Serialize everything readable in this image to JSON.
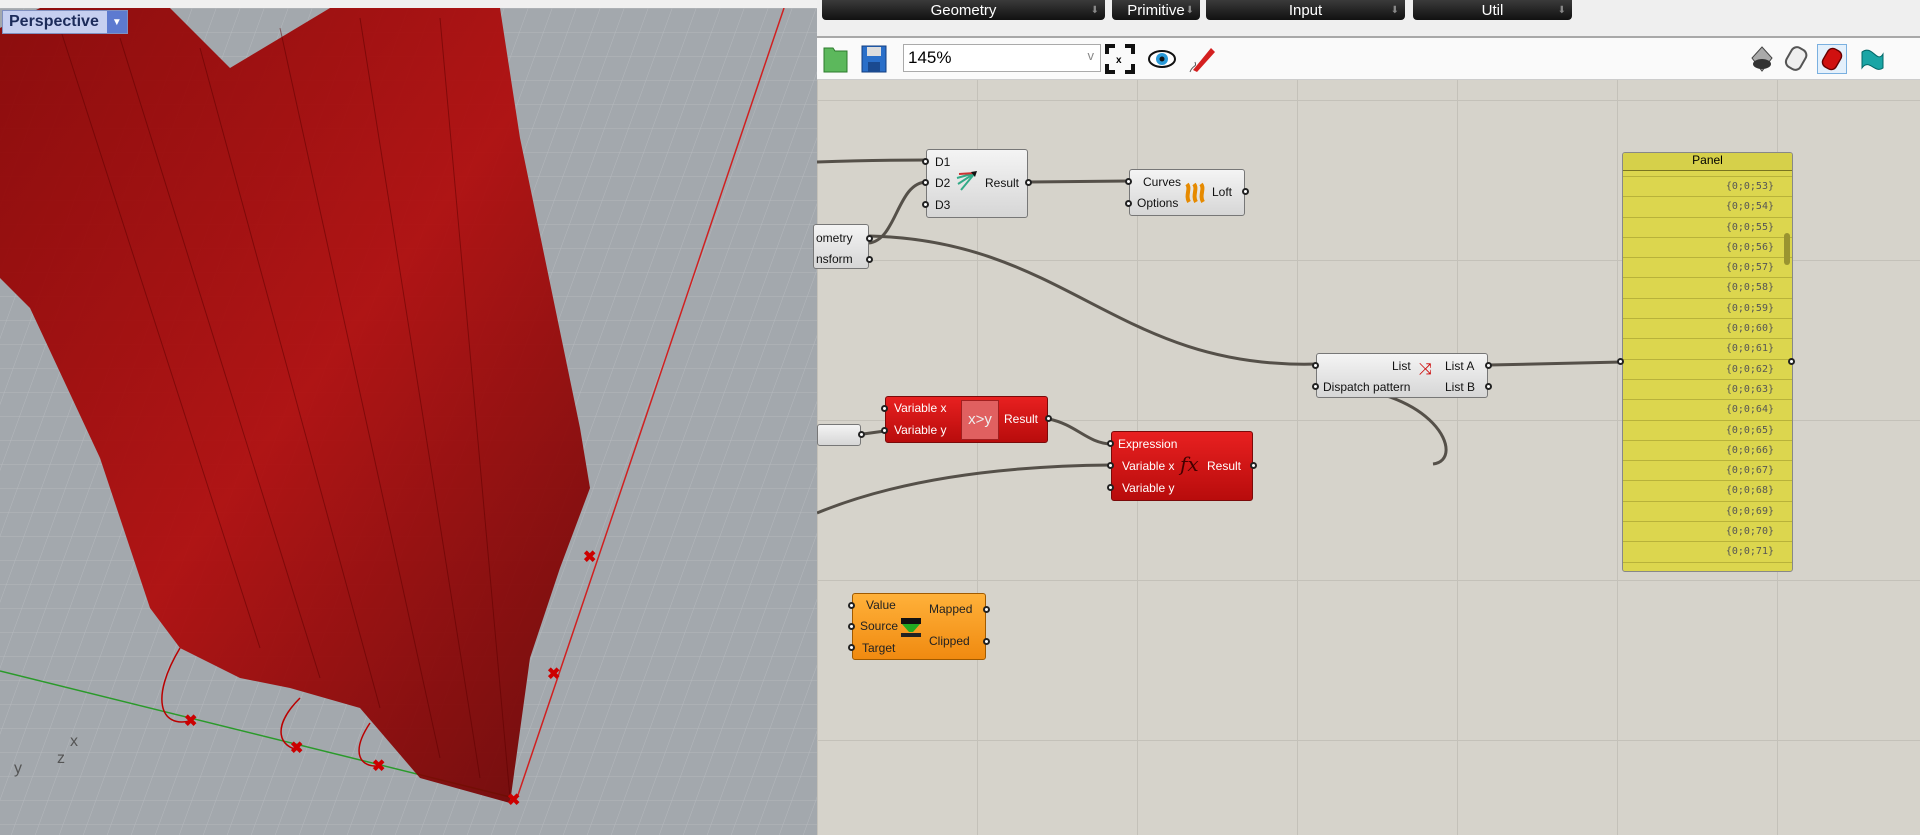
{
  "viewport": {
    "label": "Perspective",
    "axes": {
      "x": "x",
      "y": "y",
      "z": "z"
    }
  },
  "tabs": [
    {
      "label": "Geometry"
    },
    {
      "label": "Primitive"
    },
    {
      "label": "Input"
    },
    {
      "label": "Util"
    }
  ],
  "toolbar": {
    "zoom": "145%"
  },
  "components": {
    "merge": {
      "inputs": [
        "D1",
        "D2",
        "D3"
      ],
      "output": "Result"
    },
    "loft": {
      "inputs": [
        "Curves",
        "Options"
      ],
      "output": "Loft"
    },
    "transform": {
      "outputs": [
        "ometry",
        "nsform"
      ]
    },
    "dispatch": {
      "inputs": [
        "List",
        "Dispatch pattern"
      ],
      "outputs": [
        "List A",
        "List B"
      ]
    },
    "compare": {
      "inputs": [
        "Variable x",
        "Variable y"
      ],
      "label": "x>y",
      "output": "Result"
    },
    "expression": {
      "inputs": [
        "Expression",
        "Variable x",
        "Variable y"
      ],
      "output": "Result"
    },
    "remap": {
      "inputs": [
        "Value",
        "Source",
        "Target"
      ],
      "outputs": [
        "Mapped",
        "Clipped"
      ]
    }
  },
  "panel": {
    "title": "Panel",
    "items": [
      "{0;0;53}",
      "{0;0;54}",
      "{0;0;55}",
      "{0;0;56}",
      "{0;0;57}",
      "{0;0;58}",
      "{0;0;59}",
      "{0;0;60}",
      "{0;0;61}",
      "{0;0;62}",
      "{0;0;63}",
      "{0;0;64}",
      "{0;0;65}",
      "{0;0;66}",
      "{0;0;67}",
      "{0;0;68}",
      "{0;0;69}",
      "{0;0;70}",
      "{0;0;71}"
    ]
  }
}
